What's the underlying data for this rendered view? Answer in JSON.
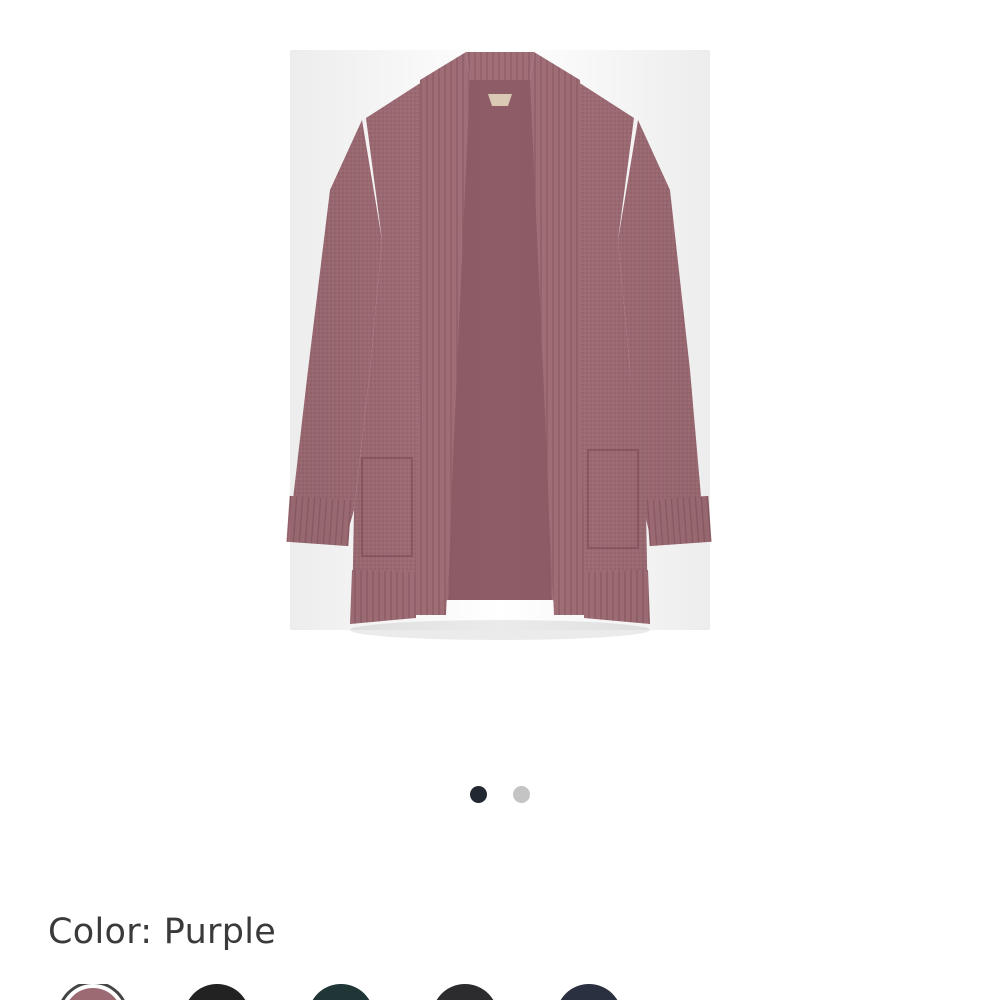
{
  "gallery": {
    "product_alt": "cardigan",
    "dots": [
      {
        "state": "active"
      },
      {
        "state": "inactive"
      }
    ]
  },
  "color": {
    "label": "Color: Purple"
  },
  "swatches": [
    {
      "name": "purple",
      "color": "#9c6a72",
      "selected": true
    },
    {
      "name": "black",
      "color": "#222222",
      "selected": false
    },
    {
      "name": "dark-teal",
      "color": "#1f3536",
      "selected": false
    },
    {
      "name": "charcoal",
      "color": "#2c2c2e",
      "selected": false
    },
    {
      "name": "navy",
      "color": "#2a3040",
      "selected": false
    }
  ],
  "colors": {
    "garment": "#a06d76",
    "garment_dark": "#8a5962",
    "garment_light": "#b78a91",
    "dot_active": "#222831",
    "dot_inactive": "#c4c4c4"
  }
}
